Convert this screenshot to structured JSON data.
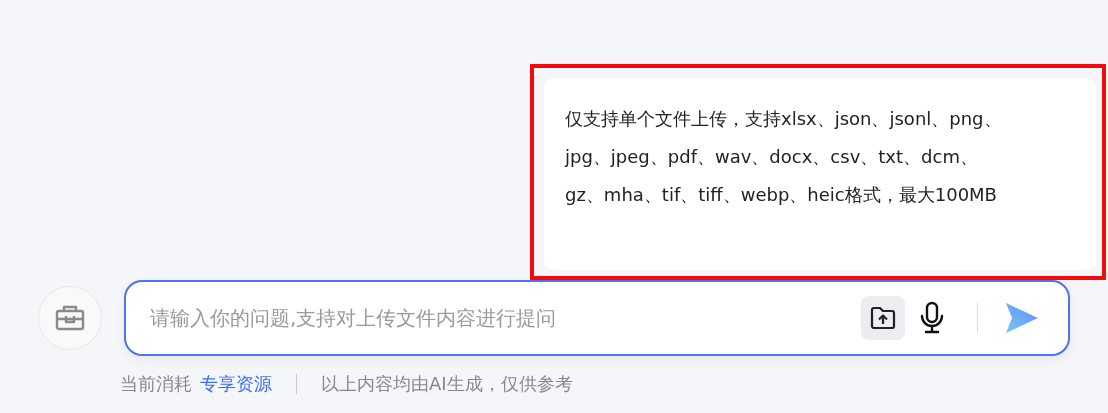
{
  "tooltip": {
    "text": "仅支持单个文件上传，支持xlsx、json、jsonl、png、jpg、jpeg、pdf、wav、docx、csv、txt、dcm、gz、mha、tif、tiff、webp、heic格式，最大100MB"
  },
  "input": {
    "placeholder": "请输入你的问题,支持对上传文件内容进行提问"
  },
  "footer": {
    "usage_label": "当前消耗",
    "usage_link": "专享资源",
    "disclaimer": "以上内容均由AI生成，仅供参考"
  }
}
